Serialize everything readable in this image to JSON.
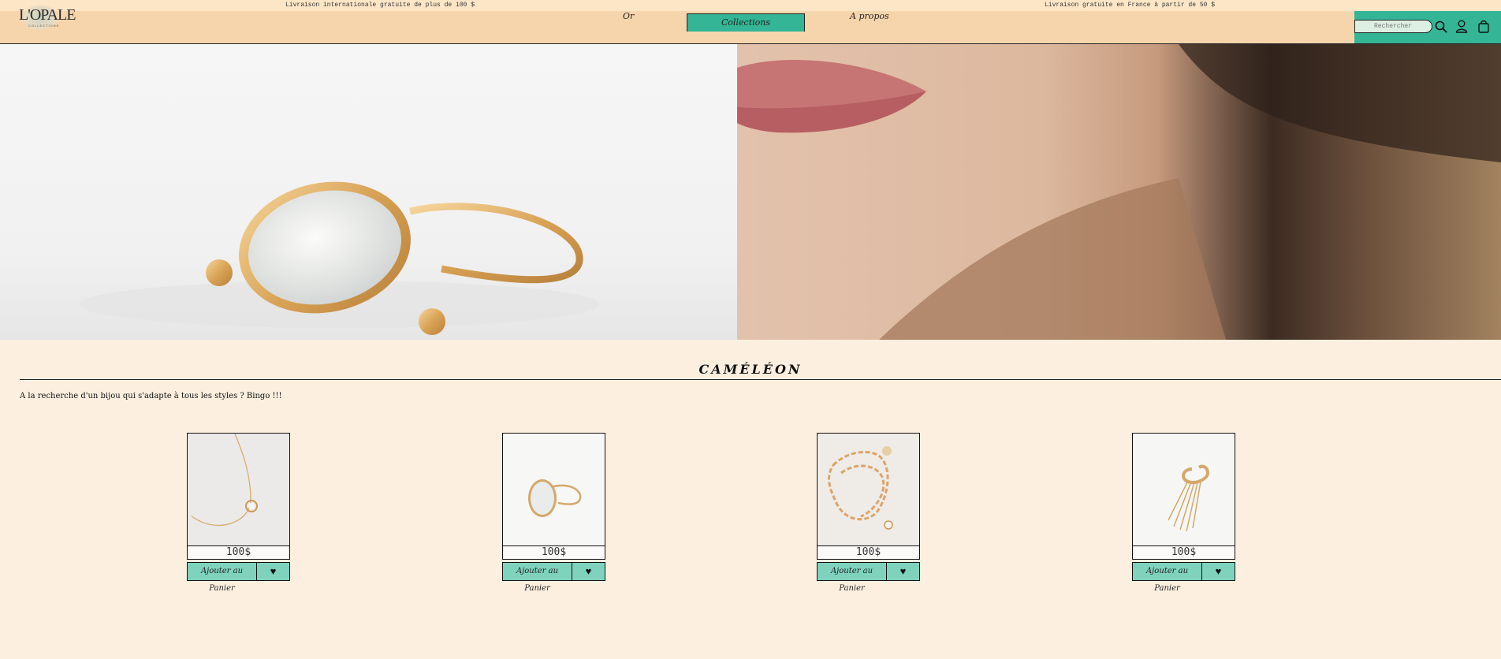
{
  "topbar": {
    "left_notice": "Livraison internationale gratuite de plus de 100 $",
    "right_notice": "Livraison gratuite en France à partir de 50 $"
  },
  "header": {
    "logo_text": "L'OPALE",
    "logo_sub": "COLLECTIONS",
    "nav": {
      "or": "Or",
      "collections": "Collections",
      "about": "A propos"
    },
    "search_placeholder": "Rechercher",
    "icons": [
      "search-icon",
      "user-icon",
      "bag-icon"
    ],
    "accent_color": "#33b596"
  },
  "hero": {
    "left_image": "ring-image",
    "right_image": "model-closeup-image"
  },
  "section": {
    "title": "CAMÉLÉON",
    "description": "A la recherche d'un bijou qui s'adapte à tous les styles ? Bingo !!!"
  },
  "products": [
    {
      "image": "necklace-image",
      "price": "100$",
      "add_label": "Ajouter au Panier",
      "fav_label": "♥"
    },
    {
      "image": "ring-image",
      "price": "100$",
      "add_label": "Ajouter au Panier",
      "fav_label": "♥"
    },
    {
      "image": "chain-bracelet-image",
      "price": "100$",
      "add_label": "Ajouter au Panier",
      "fav_label": "♥"
    },
    {
      "image": "ear-cuff-image",
      "price": "100$",
      "add_label": "Ajouter au Panier",
      "fav_label": "♥"
    }
  ]
}
